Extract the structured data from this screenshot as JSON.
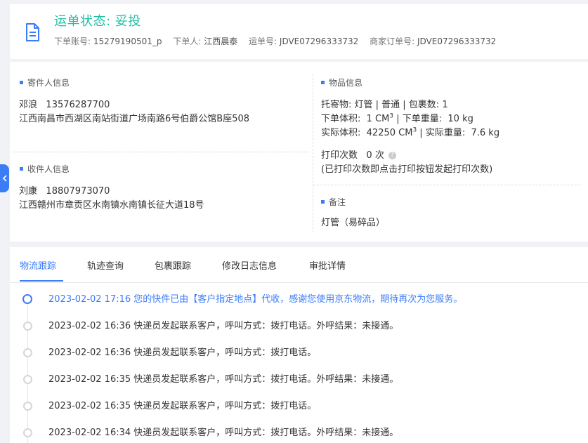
{
  "header": {
    "status": "运单状态: 妥投",
    "order_account_label": "下单账号:",
    "order_account": "15279190501_p",
    "orderer_label": "下单人:",
    "orderer": "江西晨泰",
    "waybill_label": "运单号:",
    "waybill": "JDVE07296333732",
    "merchant_order_label": "商家订单号:",
    "merchant_order": "JDVE07296333732"
  },
  "sender": {
    "title": "寄件人信息",
    "name": "邓浪",
    "phone": "13576287700",
    "address": "江西南昌市西湖区南站街道广场南路6号伯爵公馆B座508"
  },
  "receiver": {
    "title": "收件人信息",
    "name": "刘康",
    "phone": "18807973070",
    "address": "江西赣州市章贡区水南镇水南镇长征大道18号"
  },
  "goods": {
    "title": "物品信息",
    "item_line": "托寄物:  灯管 | 普通  |  包裹数:  1",
    "order_volume_label": "下单体积:",
    "order_volume": "1 CM",
    "order_weight_label": "下单重量:",
    "order_weight": "10 kg",
    "actual_volume_label": "实际体积:",
    "actual_volume": "42250 CM",
    "actual_weight_label": "实际重量:",
    "actual_weight": "7.6 kg",
    "print_label": "打印次数",
    "print_count": "0 次",
    "print_note": "(已打印次数即点击打印按钮发起打印次数)"
  },
  "remark": {
    "title": "备注",
    "text": "灯管（易碎品）"
  },
  "tabs": [
    {
      "label": "物流跟踪"
    },
    {
      "label": "轨迹查询"
    },
    {
      "label": "包裹跟踪"
    },
    {
      "label": "修改日志信息"
    },
    {
      "label": "审批详情"
    }
  ],
  "timeline": [
    {
      "text": "2023-02-02 17:16 您的快件已由【客户指定地点】代收，感谢您使用京东物流，期待再次为您服务。"
    },
    {
      "text": "2023-02-02 16:36 快递员发起联系客户，呼叫方式：拨打电话。外呼结果：未接通。"
    },
    {
      "text": "2023-02-02 16:36 快递员发起联系客户，呼叫方式：拨打电话。"
    },
    {
      "text": "2023-02-02 16:35 快递员发起联系客户，呼叫方式：拨打电话。外呼结果：未接通。"
    },
    {
      "text": "2023-02-02 16:35 快递员发起联系客户，呼叫方式：拨打电话。"
    },
    {
      "text": "2023-02-02 16:34 快递员发起联系客户，呼叫方式：拨打电话。外呼结果：未接通。"
    }
  ],
  "colors": {
    "accent": "#3b7cf7",
    "status": "#1fbfa5"
  },
  "icons": {
    "document": "document-icon",
    "help": "question-icon",
    "collapse": "chevron-left-icon"
  }
}
